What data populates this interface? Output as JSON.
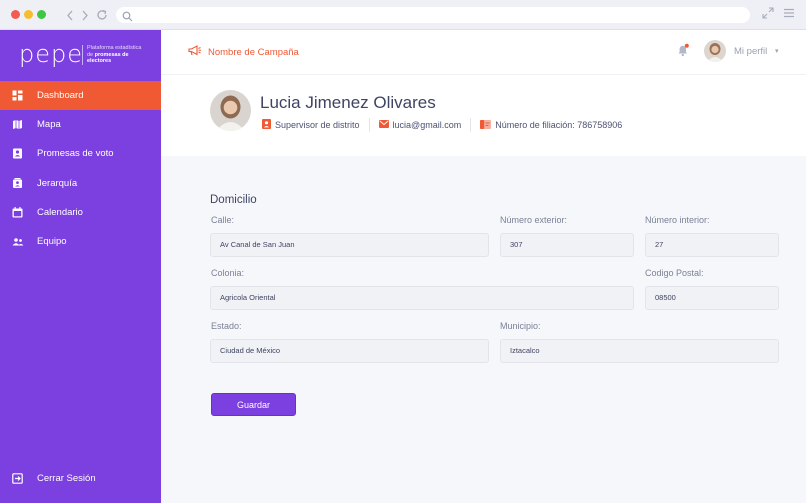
{
  "brand": {
    "logo_text": "pepe",
    "tagline_line1": "Plataforma estadística",
    "tagline_line2_prefix": "de",
    "tagline_line2_bold": "promesas de",
    "tagline_line3_bold": "electores"
  },
  "sidebar": {
    "items": [
      {
        "label": "Dashboard",
        "icon": "dashboard-icon"
      },
      {
        "label": "Mapa",
        "icon": "map-icon"
      },
      {
        "label": "Promesas de voto",
        "icon": "id-card-icon"
      },
      {
        "label": "Jerarquía",
        "icon": "contacts-icon"
      },
      {
        "label": "Calendario",
        "icon": "calendar-icon"
      },
      {
        "label": "Equipo",
        "icon": "team-icon"
      }
    ],
    "active_index": 0,
    "logout_label": "Cerrar Sesión"
  },
  "topbar": {
    "campaign": "Nombre de Campaña",
    "profile_label": "Mi perfil",
    "caret": "▾"
  },
  "profile": {
    "name": "Lucia Jimenez Olivares",
    "role": "Supervisor de distrito",
    "email": "lucia@gmail.com",
    "affiliation": "Número de filiación: 786758906"
  },
  "form": {
    "section_title": "Domicilio",
    "calle": {
      "label": "Calle:",
      "value": "Av Canal de San Juan"
    },
    "num_ext": {
      "label": "Número exterior:",
      "value": "307"
    },
    "num_int": {
      "label": "Número interior:",
      "value": "27"
    },
    "colonia": {
      "label": "Colonia:",
      "value": "Agricola Oriental"
    },
    "cp": {
      "label": "Codigo Postal:",
      "value": "08500"
    },
    "estado": {
      "label": "Estado:",
      "value": "Ciudad de México"
    },
    "municipio": {
      "label": "Municipio:",
      "value": "Iztacalco"
    },
    "save_label": "Guardar"
  },
  "colors": {
    "primary": "#7c3fe0",
    "accent": "#ef5a35"
  }
}
